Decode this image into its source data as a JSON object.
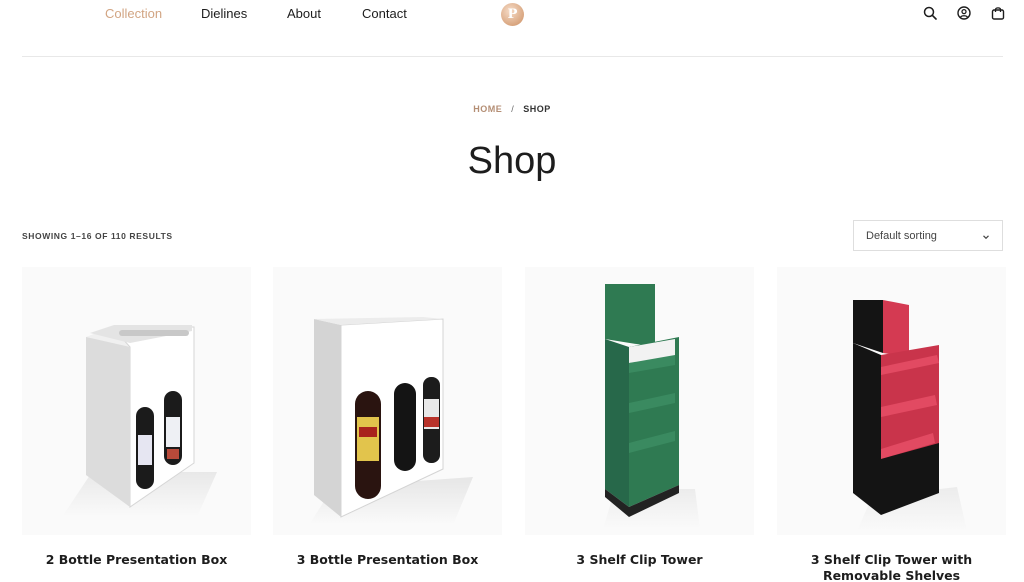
{
  "nav": {
    "items": [
      {
        "label": "Collection",
        "active": true
      },
      {
        "label": "Dielines",
        "active": false
      },
      {
        "label": "About",
        "active": false
      },
      {
        "label": "Contact",
        "active": false
      }
    ],
    "logo_letter": "P"
  },
  "header_icons": [
    "search-icon",
    "account-icon",
    "cart-icon"
  ],
  "breadcrumb": {
    "home": "HOME",
    "separator": "/",
    "current": "SHOP"
  },
  "page_title": "Shop",
  "results_text": "SHOWING 1–16 OF 110 RESULTS",
  "sorting": {
    "selected": "Default sorting"
  },
  "products": [
    {
      "name": "2 Bottle Presentation Box"
    },
    {
      "name": "3 Bottle Presentation Box"
    },
    {
      "name": "3 Shelf Clip Tower"
    },
    {
      "name": "3 Shelf Clip Tower with Removable Shelves"
    }
  ],
  "colors": {
    "accent": "#d2a583",
    "breadcrumb_home": "#b48e74",
    "tower_green": "#2f7a52",
    "tower_red": "#d43a52",
    "tower_black": "#141414"
  }
}
